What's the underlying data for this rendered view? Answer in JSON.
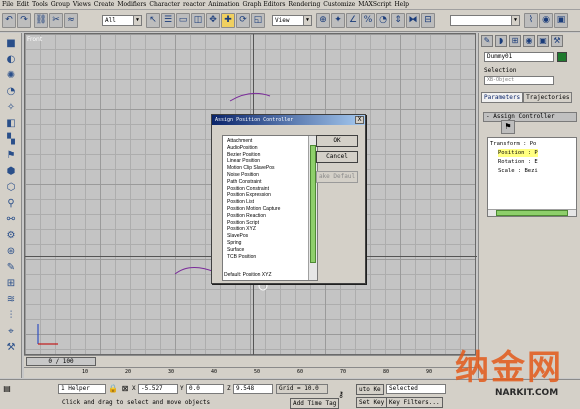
{
  "menu": [
    "File",
    "Edit",
    "Tools",
    "Group",
    "Views",
    "Create",
    "Modifiers",
    "Character",
    "reactor",
    "Animation",
    "Graph Editors",
    "Rendering",
    "Customize",
    "MAXScript",
    "Help"
  ],
  "toolbar": {
    "filter_select": "All",
    "refcoord_select": "View"
  },
  "viewport": {
    "label": "Front"
  },
  "dialog": {
    "title": "Assign Position Controller",
    "close": "X",
    "items": [
      "Attachment",
      "AudioPosition",
      "Bezier Position",
      "Linear Position",
      "Motion Clip SlavePos",
      "Noise Position",
      "Path Constraint",
      "Position Constraint",
      "Position Expression",
      "Position List",
      "Position Motion Capture",
      "Position Reaction",
      "Position Script",
      "Position XYZ",
      "SlavePos",
      "Spring",
      "Surface",
      "TCB Position"
    ],
    "default_text": "Default: Position XYZ",
    "ok": "OK",
    "cancel": "Cancel",
    "make_default": "ake Defaul"
  },
  "command_panel": {
    "object_name": "Dummy01",
    "selection_label": "Selection",
    "selection_value": "XB-Object",
    "tab_parameters": "Parameters",
    "tab_trajectories": "Trajectories",
    "rollout": "- Assign Controller",
    "tree": {
      "transform": "Transform : Po",
      "position": "Position : P",
      "rotation": "Rotation : E",
      "scale": "Scale : Bezi"
    },
    "color": "#1f7a2e"
  },
  "timeline": {
    "slider": "0 / 100",
    "ticks": [
      "10",
      "20",
      "30",
      "40",
      "50",
      "60",
      "70",
      "80",
      "90"
    ]
  },
  "status": {
    "helper": "1 Helper",
    "x_label": "X",
    "x_value": "-5.527",
    "y_label": "Y",
    "y_value": "0.0",
    "z_label": "Z",
    "z_value": "9.548",
    "grid": "Grid = 10.0",
    "prompt": "Click and drag to select and move objects",
    "add_time_tag": "Add Time Tag",
    "auto_key": "uto Ke",
    "set_key": "Set Key",
    "selected": "Selected",
    "key_filters": "Key Filters..."
  },
  "watermark": {
    "main": "纳金网",
    "sub": "NARKIT.COM"
  }
}
